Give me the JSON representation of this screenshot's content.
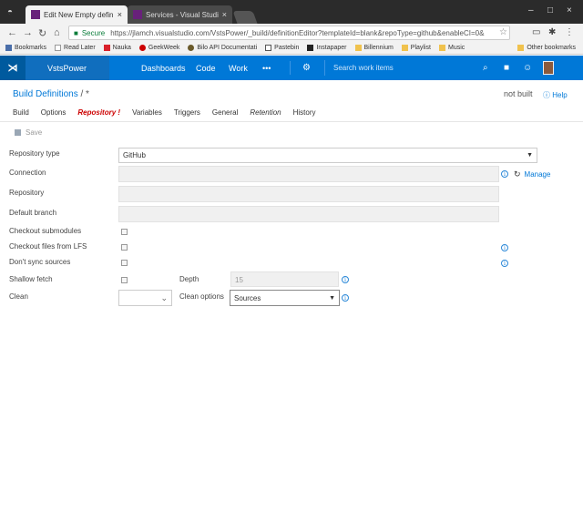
{
  "browser": {
    "tabs": [
      {
        "title": "Edit New Empty definitio",
        "close": "×"
      },
      {
        "title": "Services - Visual Studio T",
        "close": "×"
      }
    ],
    "window_controls": [
      "–",
      "□",
      "×"
    ],
    "secure_label": "Secure",
    "url": "https://jlamch.visualstudio.com/VstsPower/_build/definitionEditor?templateId=blank&repoType=github&enableCI=0&",
    "bookmarks": [
      {
        "label": "Bookmarks",
        "color": "#4a6ea9"
      },
      {
        "label": "Read Later",
        "color": "#ffffff"
      },
      {
        "label": "Nauka",
        "color": "#d9202a"
      },
      {
        "label": "GeekWeek",
        "color": "#cc0000"
      },
      {
        "label": "Bilo API Documentati",
        "color": "#6a5a2a"
      },
      {
        "label": "Pastebin",
        "color": "#555555"
      },
      {
        "label": "Instapaper",
        "color": "#222222"
      },
      {
        "label": "Billennium",
        "color": "#f0c24d"
      },
      {
        "label": "Playlist",
        "color": "#f0c24d"
      },
      {
        "label": "Music",
        "color": "#f0c24d"
      }
    ],
    "other_bookmarks": "Other bookmarks"
  },
  "vsts": {
    "project": "VstsPower",
    "nav": [
      "Dashboards",
      "Code",
      "Work",
      "•••"
    ],
    "search_placeholder": "Search work items",
    "accent": "#0078d7"
  },
  "page": {
    "title": "Build Definitions",
    "title_tail": " / *",
    "status": "not built",
    "help": "Help",
    "tabs": [
      "Build",
      "Options",
      "Repository",
      "Variables",
      "Triggers",
      "General",
      "Retention",
      "History"
    ],
    "active_tab_marker": "!",
    "save": "Save"
  },
  "form": {
    "repository_type_label": "Repository type",
    "repository_type_value": "GitHub",
    "connection_label": "Connection",
    "manage": "Manage",
    "repository_label": "Repository",
    "default_branch_label": "Default branch",
    "checkout_submodules_label": "Checkout submodules",
    "checkout_lfs_label": "Checkout files from LFS",
    "dont_sync_label": "Don't sync sources",
    "shallow_fetch_label": "Shallow fetch",
    "depth_label": "Depth",
    "depth_value": "15",
    "clean_label": "Clean",
    "clean_value": "",
    "clean_options_label": "Clean options",
    "clean_options_value": "Sources"
  }
}
